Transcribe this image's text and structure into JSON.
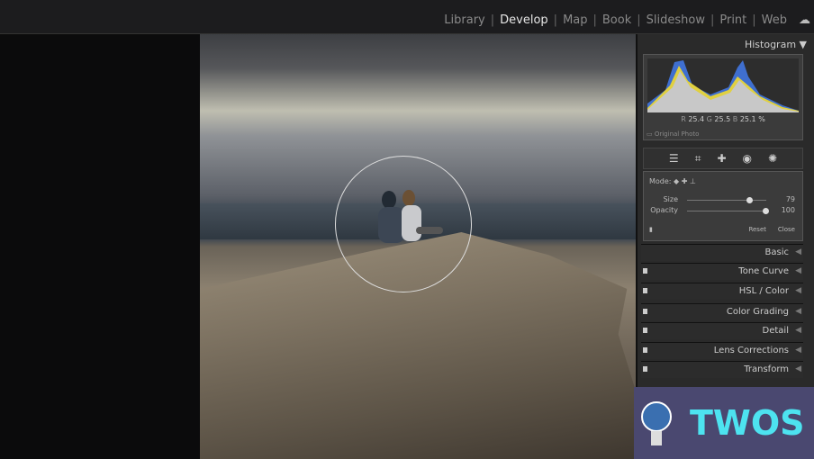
{
  "nav": {
    "modules": [
      "Library",
      "Develop",
      "Map",
      "Book",
      "Slideshow",
      "Print",
      "Web"
    ],
    "active": "Develop"
  },
  "histogram": {
    "title": "Histogram",
    "r_label": "R",
    "r": "25.4",
    "g_label": "G",
    "g": "25.5",
    "b_label": "B",
    "b": "25.1",
    "pct": "%",
    "original_photo": "Original Photo"
  },
  "healing": {
    "mode_label": "Mode:",
    "size_label": "Size",
    "size": "79",
    "opacity_label": "Opacity",
    "opacity": "100",
    "size_value": 79,
    "opacity_value": 100,
    "reset": "Reset",
    "close": "Close"
  },
  "sections": [
    "Basic",
    "Tone Curve",
    "HSL / Color",
    "Color Grading",
    "Detail",
    "Lens Corrections",
    "Transform"
  ],
  "watermark": "TWOS"
}
